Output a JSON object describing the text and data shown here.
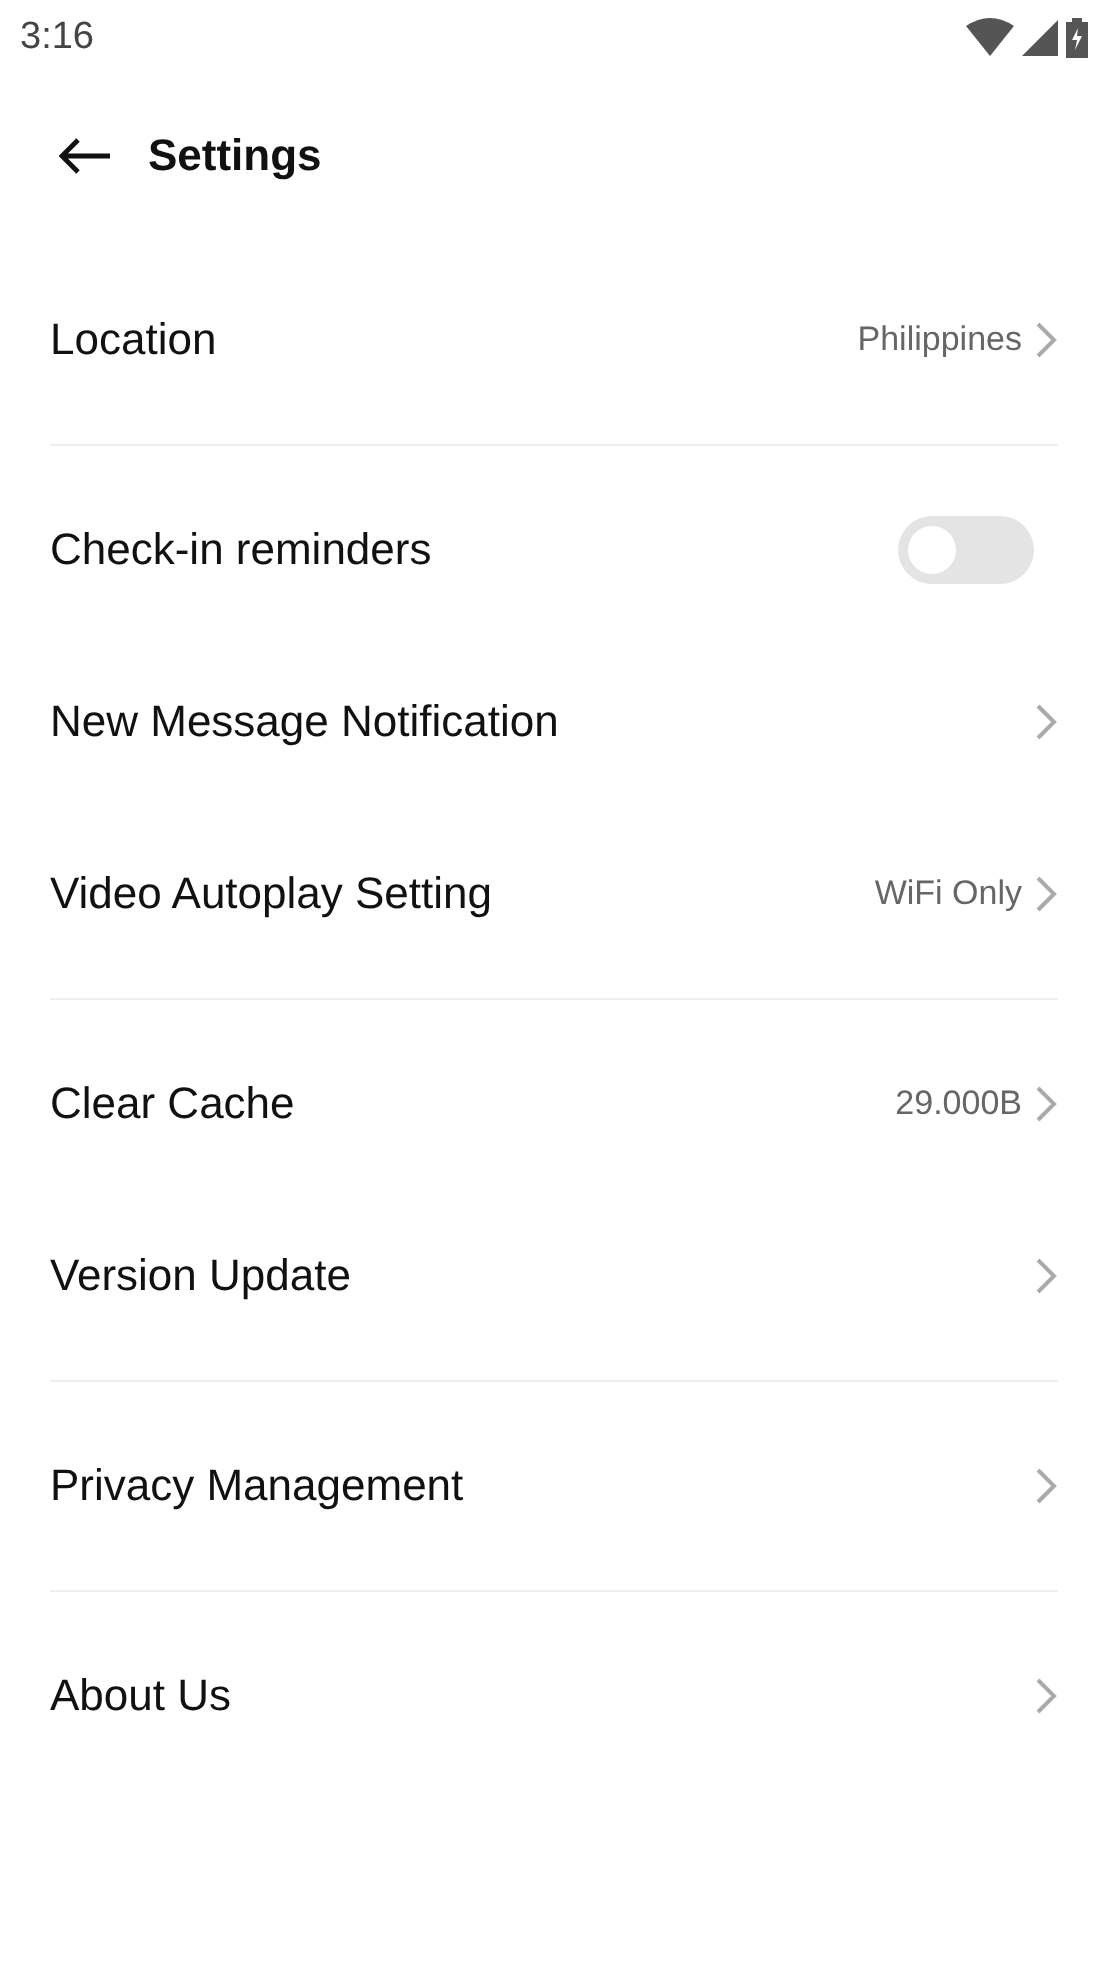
{
  "status_bar": {
    "time": "3:16"
  },
  "header": {
    "title": "Settings"
  },
  "groups": [
    {
      "rows": [
        {
          "kind": "link",
          "label": "Location",
          "value": "Philippines"
        }
      ]
    },
    {
      "rows": [
        {
          "kind": "toggle",
          "label": "Check-in reminders",
          "on": false
        },
        {
          "kind": "link",
          "label": "New Message Notification"
        },
        {
          "kind": "link",
          "label": "Video Autoplay Setting",
          "value": "WiFi Only"
        }
      ]
    },
    {
      "rows": [
        {
          "kind": "link",
          "label": "Clear Cache",
          "value": "29.000B"
        },
        {
          "kind": "link",
          "label": "Version Update"
        }
      ]
    },
    {
      "rows": [
        {
          "kind": "link",
          "label": "Privacy Management"
        }
      ]
    },
    {
      "rows": [
        {
          "kind": "link",
          "label": "About Us"
        }
      ]
    }
  ]
}
